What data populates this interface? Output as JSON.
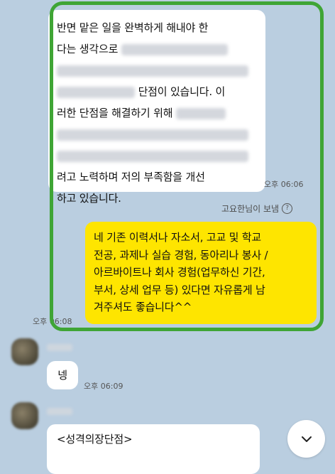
{
  "messages": {
    "top_bubble": {
      "line1": "반면 맡은 일을 완벽하게 해내야 한",
      "line2": "다는 생각으로",
      "line3": "단점이 있습니다. 이",
      "line4": "러한 단점을 해결하기 위해",
      "line5": "려고 노력하며 저의 부족함을 개선",
      "line6": "하고 있습니다.",
      "time": "오후 06:06"
    },
    "sent_notice": "고요한님이 보냄",
    "my_bubble": {
      "lines": [
        "네 기존 이력서나 자소서, 고교 및 학교",
        "전공, 과제나 실습 경험, 동아리나 봉사 /",
        "아르바이트나 회사 경험(업무하신 기간,",
        "부서, 상세 업무 등) 있다면 자유롭게 남",
        "겨주셔도 좋습니다^^"
      ],
      "time": "오후 06:08"
    },
    "reply1": {
      "text": "넹",
      "time": "오후 06:09"
    },
    "reply2": {
      "text": "<성격의장단점>"
    }
  },
  "colors": {
    "background": "#bacee0",
    "my_bubble": "#fee500",
    "other_bubble": "#ffffff",
    "highlight_border": "#3fa535"
  },
  "icons": {
    "info": "info-circle-icon",
    "scroll_down": "chevron-down-icon"
  }
}
